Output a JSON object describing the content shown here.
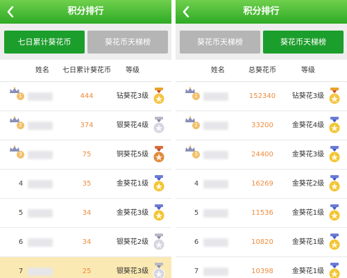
{
  "colors": {
    "header_gradient_top": "#6fd04d",
    "header_gradient_bottom": "#2eaa25",
    "tab_active": "#1c9e2c",
    "tab_inactive": "#b5b5b5",
    "value_text": "#ef8b3c",
    "highlight_row": "#fbe9b3"
  },
  "icons": {
    "back": "chevron-left-icon",
    "top_rank": "crown-icon",
    "badge": "medal-icon"
  },
  "screens": [
    {
      "header": {
        "title": "积分排行"
      },
      "tabs": [
        {
          "label": "七日累计葵花币",
          "active": true
        },
        {
          "label": "葵花币天梯榜",
          "active": false
        }
      ],
      "columns": [
        "姓名",
        "七日累计葵花币",
        "等级"
      ],
      "rows": [
        {
          "rank": "1",
          "crown": true,
          "value": "444",
          "level": "钻葵花3级",
          "badge": "diamond",
          "highlight": false
        },
        {
          "rank": "2",
          "crown": true,
          "value": "374",
          "level": "银葵花4级",
          "badge": "silver",
          "highlight": false
        },
        {
          "rank": "3",
          "crown": true,
          "value": "75",
          "level": "铜葵花5级",
          "badge": "bronze",
          "highlight": false
        },
        {
          "rank": "4",
          "crown": false,
          "value": "35",
          "level": "金葵花1级",
          "badge": "gold",
          "highlight": false
        },
        {
          "rank": "5",
          "crown": false,
          "value": "34",
          "level": "金葵花3级",
          "badge": "gold",
          "highlight": false
        },
        {
          "rank": "6",
          "crown": false,
          "value": "34",
          "level": "银葵花2级",
          "badge": "silver",
          "highlight": false
        },
        {
          "rank": "7",
          "crown": false,
          "value": "25",
          "level": "银葵花3级",
          "badge": "silver",
          "highlight": true
        }
      ]
    },
    {
      "header": {
        "title": "积分排行"
      },
      "tabs": [
        {
          "label": "葵花币天梯榜",
          "active": false
        },
        {
          "label": "葵花币天梯榜",
          "active": true
        }
      ],
      "columns": [
        "姓名",
        "总葵花币",
        "等级"
      ],
      "rows": [
        {
          "rank": "1",
          "crown": true,
          "value": "152340",
          "level": "钻葵花3级",
          "badge": "diamond",
          "highlight": false
        },
        {
          "rank": "2",
          "crown": true,
          "value": "33200",
          "level": "金葵花4级",
          "badge": "gold",
          "highlight": false
        },
        {
          "rank": "3",
          "crown": true,
          "value": "24400",
          "level": "金葵花3级",
          "badge": "gold",
          "highlight": false
        },
        {
          "rank": "4",
          "crown": false,
          "value": "16269",
          "level": "金葵花2级",
          "badge": "gold",
          "highlight": false
        },
        {
          "rank": "5",
          "crown": false,
          "value": "11536",
          "level": "金葵花1级",
          "badge": "gold",
          "highlight": false
        },
        {
          "rank": "6",
          "crown": false,
          "value": "10820",
          "level": "金葵花1级",
          "badge": "gold",
          "highlight": false
        },
        {
          "rank": "7",
          "crown": false,
          "value": "10398",
          "level": "金葵花1级",
          "badge": "gold",
          "highlight": false
        }
      ]
    }
  ]
}
